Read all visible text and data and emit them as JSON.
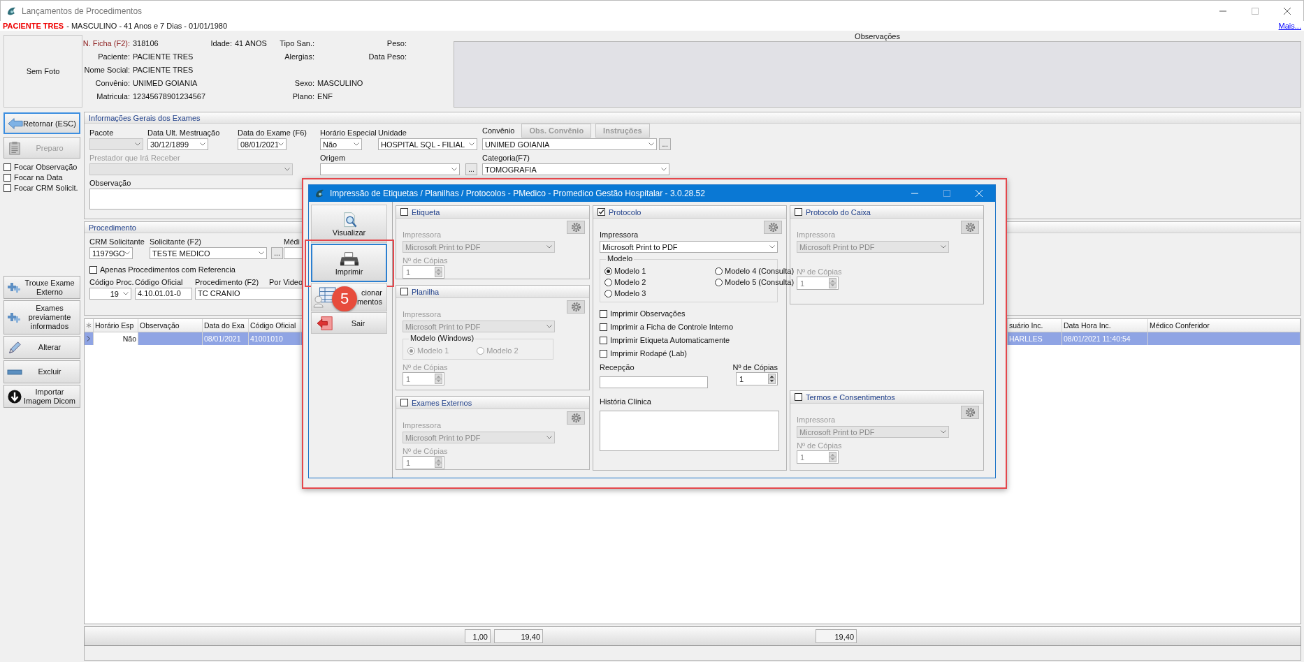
{
  "window": {
    "title": "Lançamentos de Procedimentos"
  },
  "patient_bar": {
    "name": "PACIENTE TRES",
    "details": "- MASCULINO - 41 Anos e 7 Dias - 01/01/1980",
    "more_link": "Mais..."
  },
  "header": {
    "photo": "Sem Foto",
    "rows": [
      {
        "left": {
          "label": "N. Ficha (F2):",
          "value": "318106",
          "highlighted": true
        },
        "age": {
          "label": "Idade:",
          "value": "41 ANOS",
          "highlighted": false
        },
        "center": {
          "label": "Tipo San.:",
          "highlighted": false
        },
        "right": {
          "label": "Peso:",
          "highlighted": false
        }
      },
      {
        "left": {
          "label": "Paciente:",
          "value": "PACIENTE TRES",
          "highlighted": false
        },
        "center": {
          "label": "Alergias:",
          "highlighted": false
        },
        "right": {
          "label": "Data Peso:",
          "highlighted": false
        }
      },
      {
        "left": {
          "label": "Nome Social:",
          "value": "PACIENTE TRES",
          "highlighted": false
        }
      },
      {
        "left": {
          "label": "Convênio:",
          "value": "UNIMED GOIANIA",
          "highlighted": false
        },
        "center": {
          "label": "Sexo:",
          "value": "MASCULINO",
          "highlighted": false
        }
      },
      {
        "left": {
          "label": "Matricula:",
          "value": "12345678901234567",
          "highlighted": false
        },
        "center": {
          "label": "Plano:",
          "value": "ENF",
          "highlighted": false
        }
      }
    ],
    "observations": {
      "title": "Observações"
    }
  },
  "sidebar": {
    "return_button": "Retornar (ESC)",
    "prep_button": {
      "label": "Preparo",
      "disabled": true
    },
    "checkboxes": [
      {
        "label": "Focar Observação",
        "checked": false
      },
      {
        "label": "Focar na Data",
        "checked": false
      },
      {
        "label": "Focar CRM Solicit.",
        "checked": false
      }
    ],
    "actions": [
      {
        "label": "Trouxe Exame Externo",
        "kind": "add"
      },
      {
        "label": "Exames previamente informados",
        "kind": "add"
      },
      {
        "label": "Alterar",
        "kind": "edit"
      },
      {
        "label": "Excluir",
        "kind": "delete"
      },
      {
        "label": "Importar Imagem Dicom",
        "kind": "download"
      }
    ]
  },
  "general": {
    "title": "Informações Gerais dos Exames",
    "package": {
      "label": "Pacote",
      "disabled": true
    },
    "last_period": {
      "label": "Data Ult. Mestruação",
      "value": "30/12/1899"
    },
    "exam_date": {
      "label": "Data do Exame (F6)",
      "value": "08/01/2021"
    },
    "special_time": {
      "label": "Horário Especial",
      "value": "Não"
    },
    "unit": {
      "label": "Unidade",
      "value": "HOSPITAL SQL - FILIAL"
    },
    "insurance": {
      "label": "Convênio",
      "value": "UNIMED GOIANIA",
      "more": "...",
      "buttons": [
        {
          "label": "Obs. Convênio",
          "disabled": true
        },
        {
          "label": "Instruções",
          "disabled": true
        }
      ]
    },
    "provider": {
      "label": "Prestador que Irá Receber",
      "disabled": true
    },
    "origin": {
      "label": "Origem",
      "more": "..."
    },
    "category": {
      "label": "Categoria(F7)",
      "value": "TOMOGRAFIA"
    },
    "note": {
      "label": "Observação"
    }
  },
  "procedure": {
    "title": "Procedimento",
    "requester_crm": {
      "label": "CRM Solicitante",
      "value": "11979GO"
    },
    "requester": {
      "label": "Solicitante (F2)",
      "value": "TESTE MEDICO",
      "more": "..."
    },
    "doctor": {
      "label": "Médi"
    },
    "only_with_reference": {
      "label": "Apenas Procedimentos com Referencia",
      "checked": false
    },
    "proc_code": {
      "label": "Código Proc.",
      "value": "19"
    },
    "official_code": {
      "label": "Código Oficial",
      "value": "4.10.01.01-0"
    },
    "procedure_name": {
      "label": "Procedimento (F2)",
      "value": "TC CRANIO"
    },
    "video": {
      "label": "Por Video"
    }
  },
  "table": {
    "columns_left": [
      "Horário Esp",
      "Observação",
      "Data do Exa",
      "Código Oficial"
    ],
    "columns_right": [
      "suário Inc.",
      "Data Hora Inc.",
      "Médico Conferidor"
    ],
    "rows": [
      {
        "selected": true,
        "special_time": "Não",
        "exam_date": "08/01/2021",
        "official_code": "41001010",
        "user": "HARLLES",
        "created_at": "08/01/2021 11:40:54"
      }
    ]
  },
  "totals": [
    "1,00",
    "19,40",
    "19,40"
  ],
  "dialog": {
    "title": "Impressão de Etiquetas / Planilhas / Protocolos - PMedico - Promedico Gestão Hospitalar - 3.0.28.52",
    "badge": "5",
    "actions": [
      {
        "lines": [
          "Visualizar"
        ],
        "kind": "preview",
        "selected": false
      },
      {
        "lines": [
          "Imprimir"
        ],
        "kind": "print",
        "selected": true
      },
      {
        "lines": [
          "cionar",
          "mentos"
        ],
        "kind": "relate",
        "selected": false
      },
      {
        "lines": [
          "Sair"
        ],
        "kind": "exit",
        "selected": false
      }
    ],
    "panel_columns": [
      {
        "panels": [
          {
            "title": "Etiqueta",
            "checked": false,
            "printer_label": "Impressora",
            "printer": "Microsoft Print to PDF",
            "copies_label": "Nº de Cópias",
            "copies": "1"
          },
          {
            "title": "Planilha",
            "checked": false,
            "printer_label": "Impressora",
            "printer": "Microsoft Print to PDF",
            "model_group": {
              "title": "Modelo (Windows)",
              "options": [
                {
                  "label": "Modelo 1",
                  "selected": true
                },
                {
                  "label": "Modelo 2",
                  "selected": false
                }
              ]
            },
            "copies_label": "Nº de Cópias",
            "copies": "1"
          },
          {
            "title": "Exames Externos",
            "checked": false,
            "printer_label": "Impressora",
            "printer": "Microsoft Print to PDF",
            "copies_label": "Nº de Cópias",
            "copies": "1"
          }
        ]
      },
      {
        "panels": [
          {
            "title": "Protocolo",
            "checked": true,
            "printer_label": "Impressora",
            "printer": "Microsoft Print to PDF",
            "model_group": {
              "title": "Modelo",
              "options": [
                {
                  "label": "Modelo 1",
                  "selected": true
                },
                {
                  "label": "Modelo 2",
                  "selected": false
                },
                {
                  "label": "Modelo 3",
                  "selected": false
                },
                {
                  "label": "Modelo 4 (Consulta)",
                  "selected": false
                },
                {
                  "label": "Modelo 5 (Consulta)",
                  "selected": false
                }
              ]
            },
            "options": [
              {
                "label": "Imprimir Observações",
                "checked": false
              },
              {
                "label": "Imprimir a Ficha de Controle Interno",
                "checked": false
              },
              {
                "label": "Imprimir Etiqueta Automaticamente",
                "checked": false
              },
              {
                "label": "Imprimir Rodapé (Lab)",
                "checked": false
              }
            ],
            "reception_label": "Recepção",
            "copies_label": "Nº de Cópias",
            "copies": "1",
            "history_label": "História Clínica"
          }
        ]
      },
      {
        "panels": [
          {
            "title": "Protocolo do Caixa",
            "checked": false,
            "printer_label": "Impressora",
            "printer": "Microsoft Print to PDF",
            "copies_label": "Nº de Cópias",
            "copies": "1"
          },
          {
            "title": "Termos e Consentimentos",
            "checked": false,
            "printer_label": "Impressora",
            "printer": "Microsoft Print to PDF",
            "copies_label": "Nº de Cópias",
            "copies": "1"
          }
        ]
      }
    ]
  }
}
